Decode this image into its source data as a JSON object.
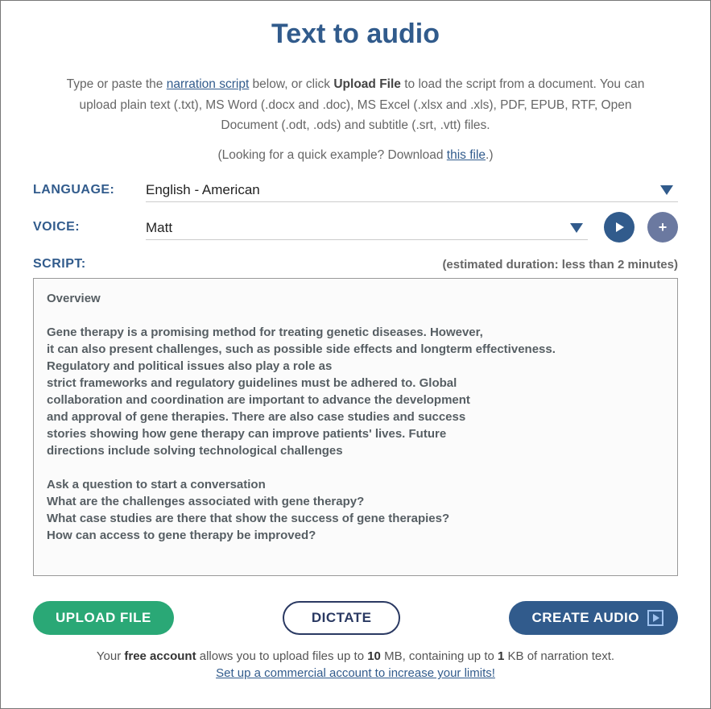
{
  "title": "Text to audio",
  "intro": {
    "part1": "Type or paste the ",
    "link1": "narration script",
    "part2": " below, or click ",
    "strong1": "Upload File",
    "part3": " to load the script from a document. You can upload plain text (.txt), MS Word (.docx and .doc), MS Excel (.xlsx and .xls), PDF, EPUB, RTF, Open Document (.odt, .ods) and subtitle (.srt, .vtt) files."
  },
  "example": {
    "part1": "(Looking for a quick example? Download ",
    "link": "this file",
    "part2": ".)"
  },
  "labels": {
    "language": "LANGUAGE:",
    "voice": "VOICE:",
    "script": "SCRIPT:"
  },
  "language": {
    "selected": "English - American"
  },
  "voice": {
    "selected": "Matt"
  },
  "duration": "(estimated duration: less than 2 minutes)",
  "script_text": "Overview\n\nGene therapy is a promising method for treating genetic diseases. However,\nit can also present challenges, such as possible side effects and longterm effectiveness.\nRegulatory and political issues also play a role as\nstrict frameworks and regulatory guidelines must be adhered to. Global\ncollaboration and coordination are important to advance the development\nand approval of gene therapies. There are also case studies and success\nstories showing how gene therapy can improve patients' lives. Future\ndirections include solving technological challenges\n\nAsk a question to start a conversation\nWhat are the challenges associated with gene therapy?\nWhat case studies are there that show the success of gene therapies?\nHow can access to gene therapy be improved?",
  "buttons": {
    "upload": "UPLOAD FILE",
    "dictate": "DICTATE",
    "create": "CREATE AUDIO"
  },
  "footer": {
    "part1": "Your ",
    "strong1": "free account",
    "part2": " allows you to upload files up to ",
    "strong2": "10",
    "part3": " MB, containing up to ",
    "strong3": "1",
    "part4": " KB of narration text.",
    "link": "Set up a commercial account to increase your limits!"
  }
}
